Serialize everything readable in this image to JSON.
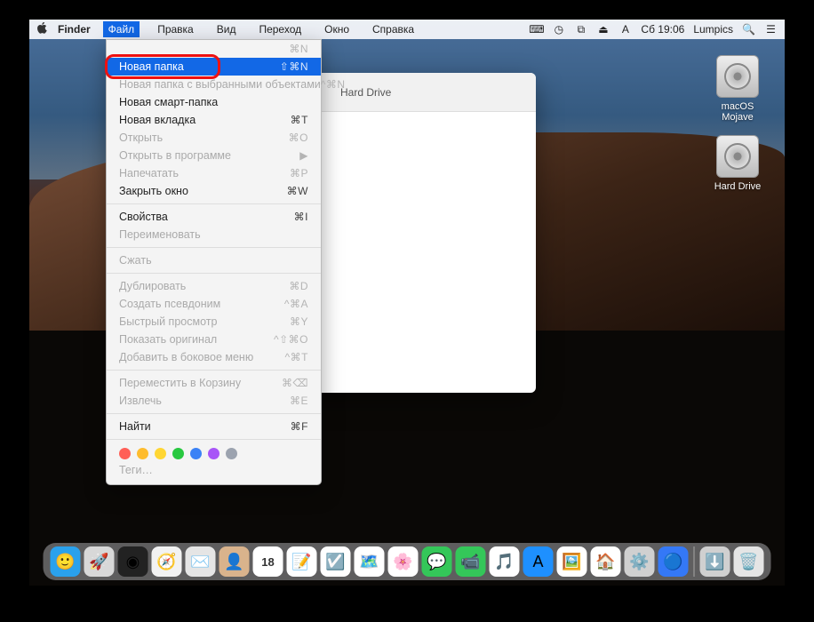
{
  "menubar": {
    "app": "Finder",
    "items": [
      "Файл",
      "Правка",
      "Вид",
      "Переход",
      "Окно",
      "Справка"
    ],
    "active_index": 0,
    "right": {
      "clock": "Сб 19:06",
      "user": "Lumpics"
    }
  },
  "dropdown": {
    "groups": [
      [
        {
          "label": "",
          "shortcut": "⌘N",
          "disabled": true
        },
        {
          "label": "Новая папка",
          "shortcut": "⇧⌘N",
          "hover": true
        },
        {
          "label": "Новая папка с выбранными объектами",
          "shortcut": "^⌘N",
          "disabled": true
        },
        {
          "label": "Новая смарт-папка",
          "shortcut": ""
        },
        {
          "label": "Новая вкладка",
          "shortcut": "⌘T"
        },
        {
          "label": "Открыть",
          "shortcut": "⌘O",
          "disabled": true
        },
        {
          "label": "Открыть в программе",
          "shortcut": "▶",
          "disabled": true
        },
        {
          "label": "Напечатать",
          "shortcut": "⌘P",
          "disabled": true
        },
        {
          "label": "Закрыть окно",
          "shortcut": "⌘W"
        }
      ],
      [
        {
          "label": "Свойства",
          "shortcut": "⌘I"
        },
        {
          "label": "Переименовать",
          "shortcut": "",
          "disabled": true
        }
      ],
      [
        {
          "label": "Сжать",
          "shortcut": "",
          "disabled": true
        }
      ],
      [
        {
          "label": "Дублировать",
          "shortcut": "⌘D",
          "disabled": true
        },
        {
          "label": "Создать псевдоним",
          "shortcut": "^⌘A",
          "disabled": true
        },
        {
          "label": "Быстрый просмотр",
          "shortcut": "⌘Y",
          "disabled": true
        },
        {
          "label": "Показать оригинал",
          "shortcut": "^⇧⌘O",
          "disabled": true
        },
        {
          "label": "Добавить в боковое меню",
          "shortcut": "^⌘T",
          "disabled": true
        }
      ],
      [
        {
          "label": "Переместить в Корзину",
          "shortcut": "⌘⌫",
          "disabled": true
        },
        {
          "label": "Извлечь",
          "shortcut": "⌘E",
          "disabled": true
        }
      ],
      [
        {
          "label": "Найти",
          "shortcut": "⌘F"
        }
      ]
    ],
    "tag_colors": [
      "#ff5f57",
      "#febc2e",
      "#ffd633",
      "#28c840",
      "#3b82f6",
      "#a855f7",
      "#9ca3af"
    ],
    "tags_label": "Теги…"
  },
  "finder_window": {
    "title": "Hard Drive"
  },
  "desktop_icons": [
    {
      "label": "macOS Mojave"
    },
    {
      "label": "Hard Drive"
    }
  ],
  "dock": [
    {
      "name": "finder",
      "bg": "#2aa1ec",
      "glyph": "🙂"
    },
    {
      "name": "launchpad",
      "bg": "#d8d8d8",
      "glyph": "🚀"
    },
    {
      "name": "siri",
      "bg": "#222",
      "glyph": "◉"
    },
    {
      "name": "safari",
      "bg": "#f2f2f2",
      "glyph": "🧭"
    },
    {
      "name": "mail",
      "bg": "#e5e5e5",
      "glyph": "✉️"
    },
    {
      "name": "contacts",
      "bg": "#d9b38c",
      "glyph": "👤"
    },
    {
      "name": "calendar",
      "bg": "#fff",
      "glyph": "18"
    },
    {
      "name": "notes",
      "bg": "#fff",
      "glyph": "📝"
    },
    {
      "name": "reminders",
      "bg": "#fff",
      "glyph": "☑️"
    },
    {
      "name": "maps",
      "bg": "#fff",
      "glyph": "🗺️"
    },
    {
      "name": "photos",
      "bg": "#fff",
      "glyph": "🌸"
    },
    {
      "name": "messages",
      "bg": "#34c759",
      "glyph": "💬"
    },
    {
      "name": "facetime",
      "bg": "#34c759",
      "glyph": "📹"
    },
    {
      "name": "itunes",
      "bg": "#fff",
      "glyph": "🎵"
    },
    {
      "name": "appstore",
      "bg": "#1e90ff",
      "glyph": "A"
    },
    {
      "name": "preview",
      "bg": "#fff",
      "glyph": "🖼️"
    },
    {
      "name": "home",
      "bg": "#fff",
      "glyph": "🏠"
    },
    {
      "name": "settings",
      "bg": "#d0d0d0",
      "glyph": "⚙️"
    },
    {
      "name": "other",
      "bg": "#3478f6",
      "glyph": "🔵"
    }
  ],
  "dock_right": [
    {
      "name": "downloads",
      "bg": "#d0d0d0",
      "glyph": "⬇️"
    },
    {
      "name": "trash",
      "bg": "#e5e5e5",
      "glyph": "🗑️"
    }
  ]
}
